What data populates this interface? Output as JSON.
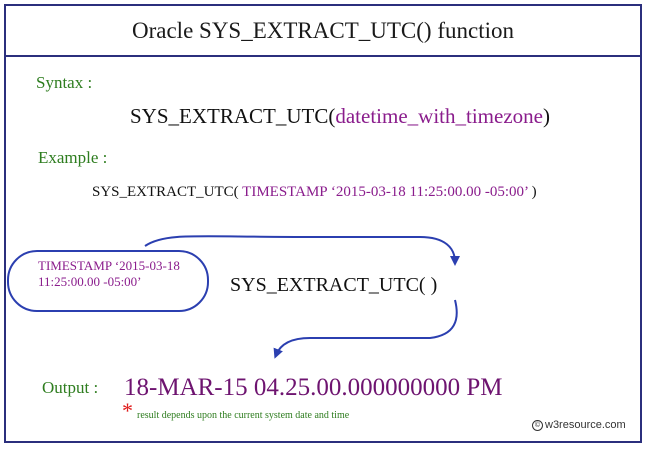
{
  "title": "Oracle SYS_EXTRACT_UTC() function",
  "syntax": {
    "label": "Syntax :",
    "function": "SYS_EXTRACT_UTC(",
    "argument": "datetime_with_timezone",
    "close": ")"
  },
  "example": {
    "label": "Example :",
    "function": "SYS_EXTRACT_UTC( ",
    "argument": "TIMESTAMP ‘2015-03-18 11:25:00.00 -05:00’",
    "close": " )"
  },
  "diagram": {
    "timestamp_box_text": "TIMESTAMP ‘2015-03-18 11:25:00.00 -05:00’",
    "center_function": "SYS_EXTRACT_UTC(    )"
  },
  "output": {
    "label": "Output :",
    "value": "18-MAR-15 04.25.00.000000000 PM",
    "asterisk": "*",
    "note": "result depends upon the current system date and time"
  },
  "brand": {
    "icon": "w3resource-logo-icon",
    "text": "w3resource.com"
  },
  "colors": {
    "border": "#2b2f7d",
    "label_green": "#2e7d1f",
    "argument_purple": "#8a1c8c",
    "arrow_blue": "#2b3fb0",
    "asterisk_red": "#e01b1b"
  }
}
